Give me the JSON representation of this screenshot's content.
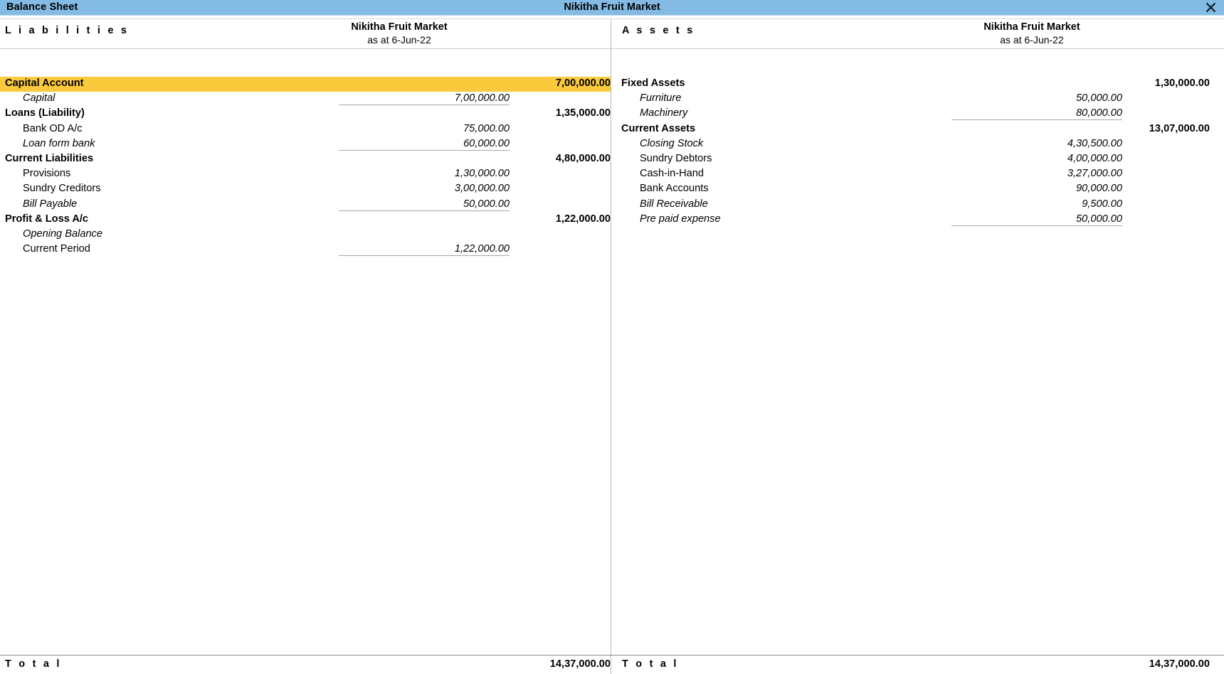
{
  "titlebar": {
    "left_label": "Balance Sheet",
    "center_label": "Nikitha Fruit Market",
    "close_icon": "close-icon",
    "bg_color": "#84bbe4"
  },
  "columns": {
    "left": {
      "side_title": "L i a b i l i t i e s",
      "company": "Nikitha Fruit Market",
      "as_at": "as at 6-Jun-22",
      "total_label": "T o t a l",
      "total_amount": "14,37,000.00",
      "rows": [
        {
          "label": "Capital Account",
          "kind": "group",
          "amount": "7,00,000.00",
          "highlight": true
        },
        {
          "label": "Capital",
          "kind": "sub-italic",
          "amount": "7,00,000.00",
          "rule": true
        },
        {
          "label": "Loans (Liability)",
          "kind": "group",
          "amount": "1,35,000.00"
        },
        {
          "label": "Bank OD A/c",
          "kind": "sub",
          "amount": "75,000.00"
        },
        {
          "label": "Loan form bank",
          "kind": "sub-italic",
          "amount": "60,000.00",
          "rule": true
        },
        {
          "label": "Current Liabilities",
          "kind": "group",
          "amount": "4,80,000.00"
        },
        {
          "label": "Provisions",
          "kind": "sub",
          "amount": "1,30,000.00"
        },
        {
          "label": "Sundry Creditors",
          "kind": "sub",
          "amount": "3,00,000.00"
        },
        {
          "label": "Bill Payable",
          "kind": "sub-italic",
          "amount": "50,000.00",
          "rule": true
        },
        {
          "label": "Profit & Loss A/c",
          "kind": "group",
          "amount": "1,22,000.00"
        },
        {
          "label": "Opening Balance",
          "kind": "sub-italic",
          "amount": ""
        },
        {
          "label": "Current Period",
          "kind": "sub",
          "amount": "1,22,000.00",
          "rule": true
        }
      ]
    },
    "right": {
      "side_title": "A s s e t s",
      "company": "Nikitha Fruit Market",
      "as_at": "as at 6-Jun-22",
      "total_label": "T o t a l",
      "total_amount": "14,37,000.00",
      "rows": [
        {
          "label": "Fixed Assets",
          "kind": "group",
          "amount": "1,30,000.00"
        },
        {
          "label": "Furniture",
          "kind": "sub-italic",
          "amount": "50,000.00"
        },
        {
          "label": "Machinery",
          "kind": "sub-italic",
          "amount": "80,000.00",
          "rule": true
        },
        {
          "label": "Current Assets",
          "kind": "group",
          "amount": "13,07,000.00"
        },
        {
          "label": "Closing Stock",
          "kind": "sub-italic",
          "amount": "4,30,500.00"
        },
        {
          "label": "Sundry Debtors",
          "kind": "sub",
          "amount": "4,00,000.00"
        },
        {
          "label": "Cash-in-Hand",
          "kind": "sub",
          "amount": "3,27,000.00"
        },
        {
          "label": "Bank Accounts",
          "kind": "sub",
          "amount": "90,000.00"
        },
        {
          "label": "Bill Receivable",
          "kind": "sub-italic",
          "amount": "9,500.00"
        },
        {
          "label": "Pre paid expense",
          "kind": "sub-italic",
          "amount": "50,000.00",
          "rule": true
        }
      ]
    }
  },
  "colors": {
    "highlight": "#fac93c",
    "title_bar": "#84bbe4",
    "divider": "#b9b9b9"
  }
}
